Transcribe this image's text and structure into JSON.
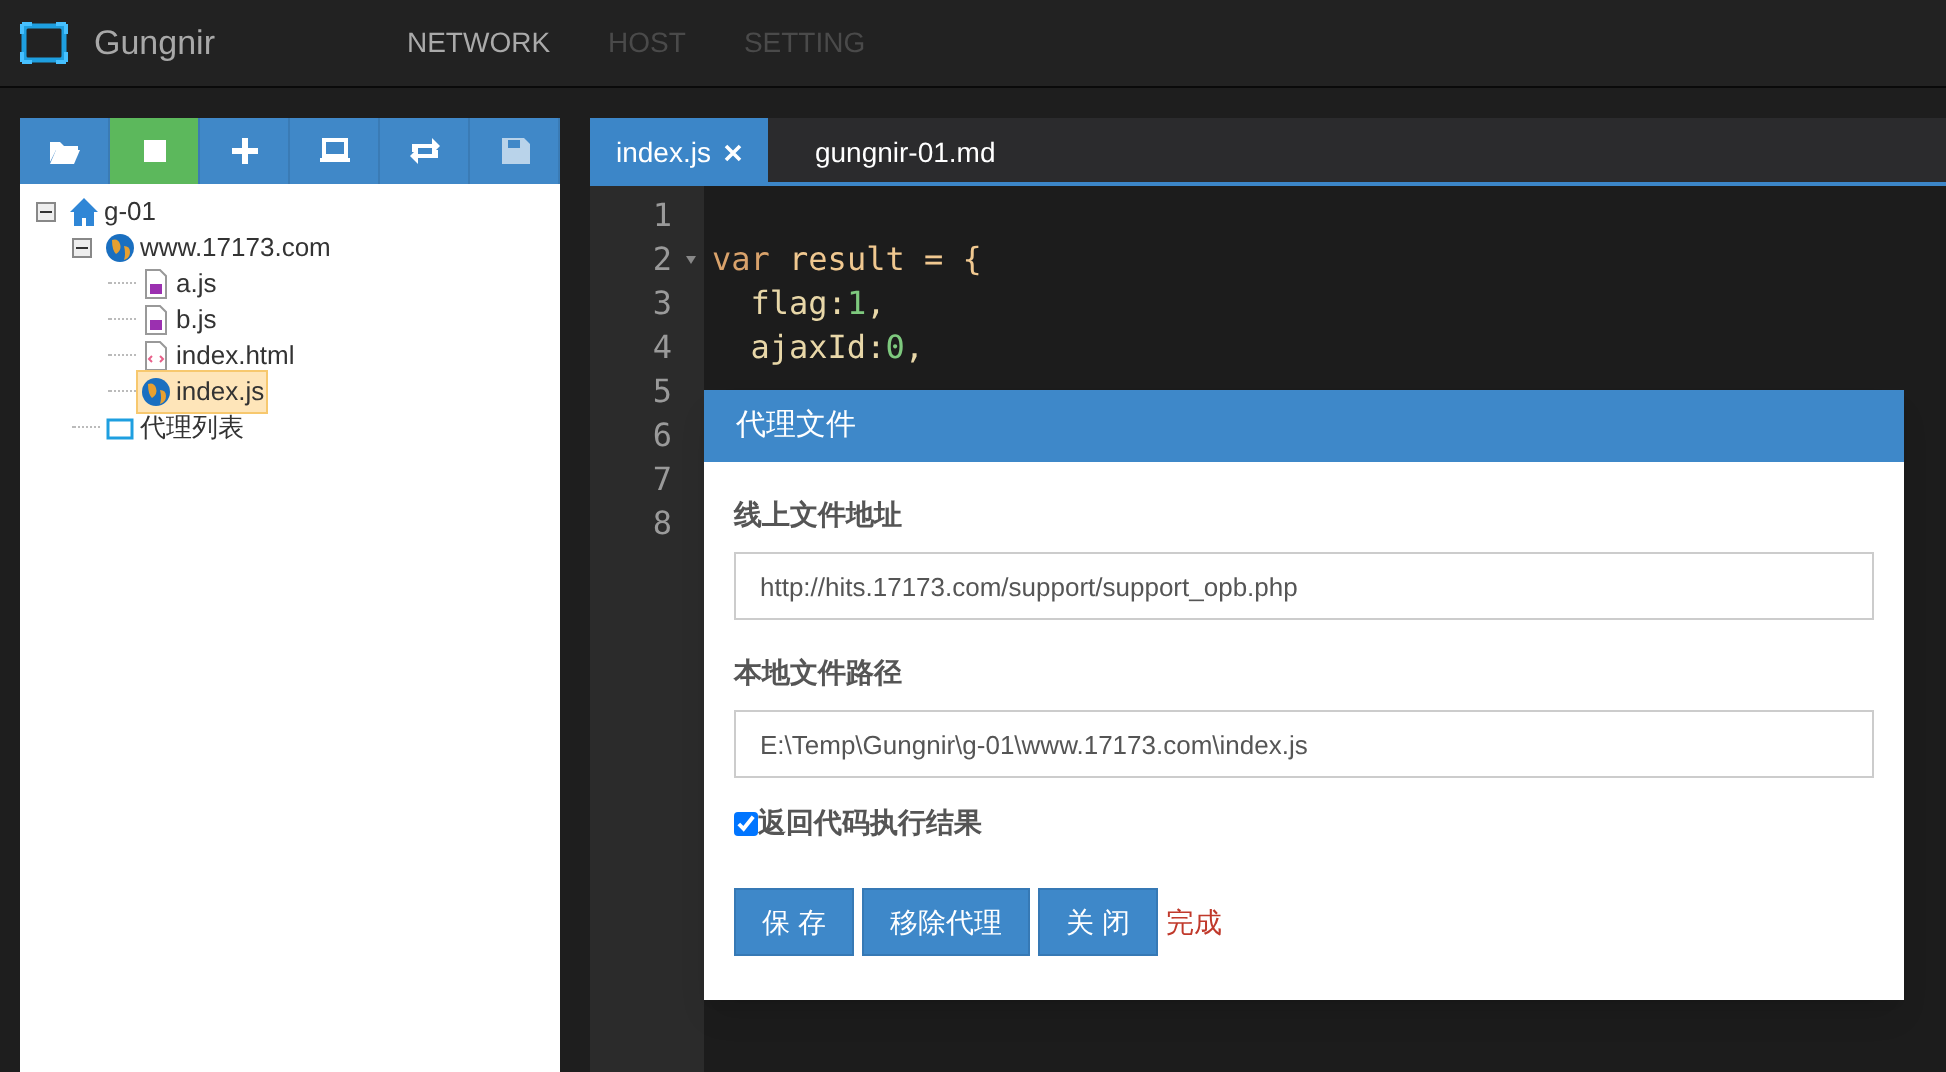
{
  "app": {
    "name": "Gungnir"
  },
  "nav": [
    {
      "label": "NETWORK",
      "selected": true
    },
    {
      "label": "HOST",
      "selected": false
    },
    {
      "label": "SETTING",
      "selected": false
    }
  ],
  "toolbar": [
    {
      "kind": "folder",
      "selected": false
    },
    {
      "kind": "stop",
      "selected": true
    },
    {
      "kind": "plus",
      "selected": false
    },
    {
      "kind": "laptop",
      "selected": false
    },
    {
      "kind": "refresh",
      "selected": false
    },
    {
      "kind": "save",
      "selected": false
    }
  ],
  "tree": [
    {
      "label": "g-01",
      "kind": "home",
      "expanded": true,
      "selected": false,
      "children": [
        {
          "label": "www.17173.com",
          "kind": "globe",
          "expanded": true,
          "selected": false,
          "children": [
            {
              "label": "a.js",
              "kind": "js",
              "selected": false
            },
            {
              "label": "b.js",
              "kind": "js",
              "selected": false
            },
            {
              "label": "index.html",
              "kind": "html",
              "selected": false
            },
            {
              "label": "index.js",
              "kind": "globe",
              "selected": true
            }
          ]
        },
        {
          "label": "代理列表",
          "kind": "list",
          "selected": false
        }
      ]
    }
  ],
  "tabs": [
    {
      "label": "index.js",
      "selected": true,
      "closable": true
    },
    {
      "label": "gungnir-01.md",
      "selected": false,
      "closable": false
    }
  ],
  "editor": {
    "lines": [
      {
        "number": "1"
      },
      {
        "number": "2",
        "fold": true,
        "tokens": [
          {
            "kind": "keyword",
            "text": "var"
          },
          {
            "kind": "ident",
            "text": " result = {"
          }
        ]
      },
      {
        "number": "3",
        "tokens": [
          {
            "kind": "plain",
            "text": "  flag:"
          },
          {
            "kind": "number",
            "text": "1"
          },
          {
            "kind": "plain",
            "text": ","
          }
        ]
      },
      {
        "number": "4",
        "tokens": [
          {
            "kind": "plain",
            "text": "  ajaxId:"
          },
          {
            "kind": "number",
            "text": "0"
          },
          {
            "kind": "plain",
            "text": ","
          }
        ]
      },
      {
        "number": "5"
      },
      {
        "number": "6"
      },
      {
        "number": "7"
      },
      {
        "number": "8"
      }
    ]
  },
  "dialog": {
    "title": "代理文件",
    "fields": [
      {
        "label": "线上文件地址",
        "value": "http://hits.17173.com/support/support_opb.php"
      },
      {
        "label": "本地文件路径",
        "value": "E:\\Temp\\Gungnir\\g-01\\www.17173.com\\index.js"
      }
    ],
    "checkbox": {
      "label": "返回代码执行结果",
      "checked": true
    },
    "buttons": [
      "保 存",
      "移除代理",
      "关 闭"
    ],
    "status": "完成"
  }
}
